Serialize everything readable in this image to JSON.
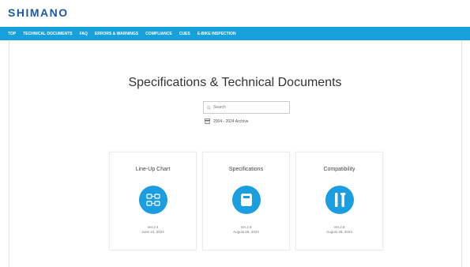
{
  "header": {
    "logo": "SHIMANO"
  },
  "nav": {
    "items": [
      "TOP",
      "TECHNICAL DOCUMENTS",
      "FAQ",
      "ERRORS & WARNINGS",
      "COMPLIANCE",
      "CUES",
      "E-BIKE INSPECTION"
    ]
  },
  "main": {
    "title": "Specifications & Technical Documents",
    "search_placeholder": "Search",
    "archive_label": "2004 - 2024 Archive"
  },
  "cards": [
    {
      "title": "Line-Up Chart",
      "version": "Ver.2.4",
      "date": "June 24, 2024",
      "icon": "lineup-chart-icon"
    },
    {
      "title": "Specifications",
      "version": "Ver.2.9",
      "date": "August 28, 2024",
      "icon": "specifications-icon"
    },
    {
      "title": "Compatibility",
      "version": "Ver.2.8",
      "date": "August 28, 2024",
      "icon": "compatibility-icon"
    }
  ],
  "colors": {
    "brand": "#1a5aa8",
    "nav_bar": "#17a0dc",
    "icon_circle": "#1a9ee0"
  }
}
